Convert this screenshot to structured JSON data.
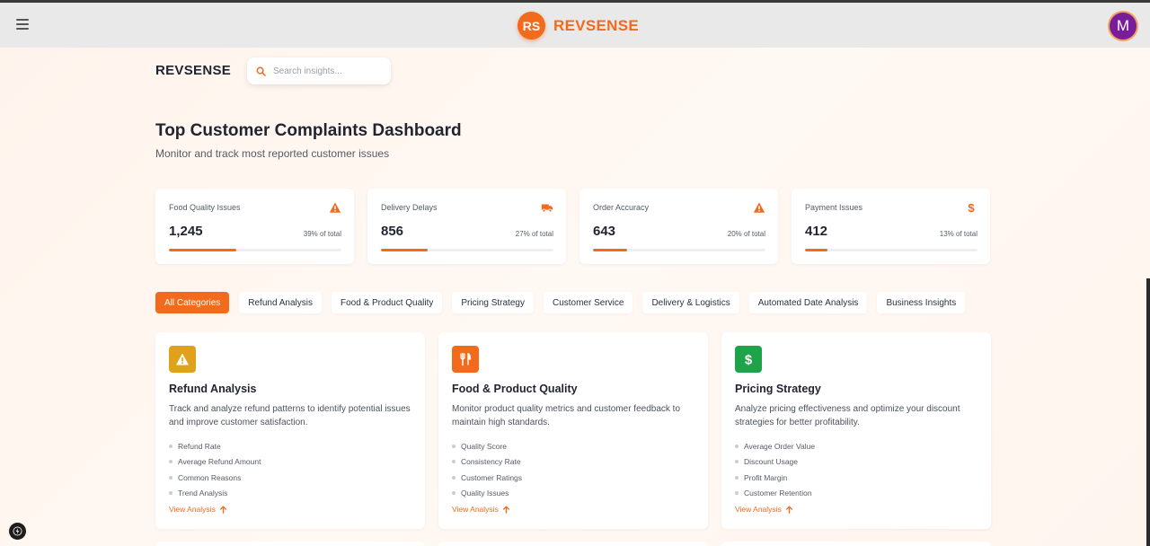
{
  "header": {
    "logo_initials": "RS",
    "brand": "REVSENSE",
    "avatar_initial": "M"
  },
  "page": {
    "brand": "REVSENSE",
    "search_placeholder": "Search insights...",
    "title": "Top Customer Complaints Dashboard",
    "subtitle": "Monitor and track most reported customer issues"
  },
  "stats": [
    {
      "label": "Food Quality Issues",
      "value": "1,245",
      "pct": "39% of total",
      "fill": 0.39,
      "icon": "warning-icon",
      "color": "#f26a1b"
    },
    {
      "label": "Delivery Delays",
      "value": "856",
      "pct": "27% of total",
      "fill": 0.27,
      "icon": "truck-icon",
      "color": "#f26a1b"
    },
    {
      "label": "Order Accuracy",
      "value": "643",
      "pct": "20% of total",
      "fill": 0.2,
      "icon": "warning-icon",
      "color": "#f26a1b"
    },
    {
      "label": "Payment Issues",
      "value": "412",
      "pct": "13% of total",
      "fill": 0.13,
      "icon": "dollar-icon",
      "color": "#f26a1b"
    }
  ],
  "filters": [
    "All Categories",
    "Refund Analysis",
    "Food & Product Quality",
    "Pricing Strategy",
    "Customer Service",
    "Delivery & Logistics",
    "Automated Date Analysis",
    "Business Insights"
  ],
  "cards": [
    {
      "title": "Refund Analysis",
      "desc": "Track and analyze refund patterns to identify potential issues and improve customer satisfaction.",
      "items": [
        "Refund Rate",
        "Average Refund Amount",
        "Common Reasons",
        "Trend Analysis"
      ],
      "link": "View Analysis",
      "icon": "warning-icon",
      "color": "#e0a21a"
    },
    {
      "title": "Food & Product Quality",
      "desc": "Monitor product quality metrics and customer feedback to maintain high standards.",
      "items": [
        "Quality Score",
        "Consistency Rate",
        "Customer Ratings",
        "Quality Issues"
      ],
      "link": "View Analysis",
      "icon": "utensils-icon",
      "color": "#f26a1b"
    },
    {
      "title": "Pricing Strategy",
      "desc": "Analyze pricing effectiveness and optimize your discount strategies for better profitability.",
      "items": [
        "Average Order Value",
        "Discount Usage",
        "Profit Margin",
        "Customer Retention"
      ],
      "link": "View Analysis",
      "icon": "dollar-icon",
      "color": "#1fa34a"
    }
  ]
}
